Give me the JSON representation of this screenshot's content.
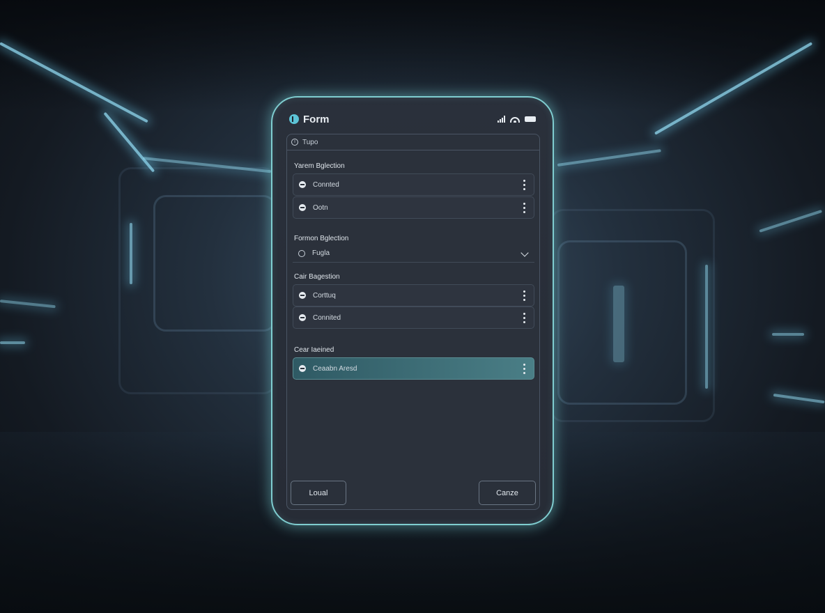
{
  "app": {
    "title": "Form",
    "icon": "form-icon"
  },
  "status_bar": {
    "icons": [
      "signal-icon",
      "wifi-icon",
      "battery-icon"
    ]
  },
  "search": {
    "label": "Tupo",
    "icon": "info-icon"
  },
  "sections": [
    {
      "label": "Yarem Bglection",
      "items": [
        {
          "label": "Connted",
          "icon": "radio-filled"
        },
        {
          "label": "Ootn",
          "icon": "radio-filled"
        }
      ]
    },
    {
      "label": "Formon Bglection",
      "select": {
        "value": "Fugla",
        "icon": "chevron-down-icon"
      }
    },
    {
      "label": "Cair Bagestion",
      "items": [
        {
          "label": "Corttuq",
          "icon": "radio-filled"
        },
        {
          "label": "Connited",
          "icon": "radio-filled"
        }
      ]
    },
    {
      "label": "Cear Iaeined",
      "items": [
        {
          "label": "Ceaabn Aresd",
          "icon": "radio-filled",
          "selected": true
        }
      ]
    }
  ],
  "buttons": {
    "left": "Loual",
    "right": "Canze"
  },
  "colors": {
    "accent": "#7fcdd0",
    "selected_row": "#4a7e86",
    "panel": "#2b313b"
  }
}
